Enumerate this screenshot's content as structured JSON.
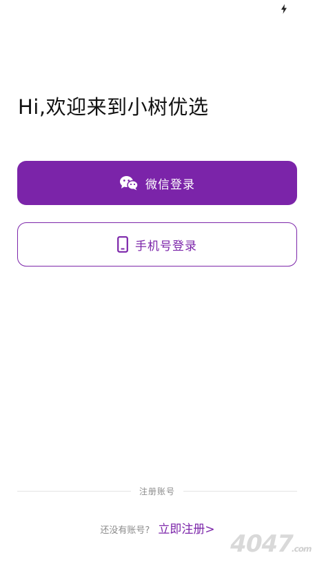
{
  "status_bar": {
    "icon": "charging-bolt-icon"
  },
  "greeting": "Hi,欢迎来到小树优选",
  "buttons": {
    "wechat_login": {
      "label": "微信登录",
      "icon": "wechat-icon",
      "color": "#7b24a9"
    },
    "phone_login": {
      "label": "手机号登录",
      "icon": "phone-icon",
      "color": "#7b24a9"
    }
  },
  "footer": {
    "divider_text": "注册账号",
    "no_account_text": "还没有账号?",
    "register_link": "立即注册>"
  },
  "watermark": {
    "text": "4047",
    "suffix": ".com"
  },
  "colors": {
    "accent": "#7b24a9",
    "muted_text": "#8c8c8c"
  }
}
